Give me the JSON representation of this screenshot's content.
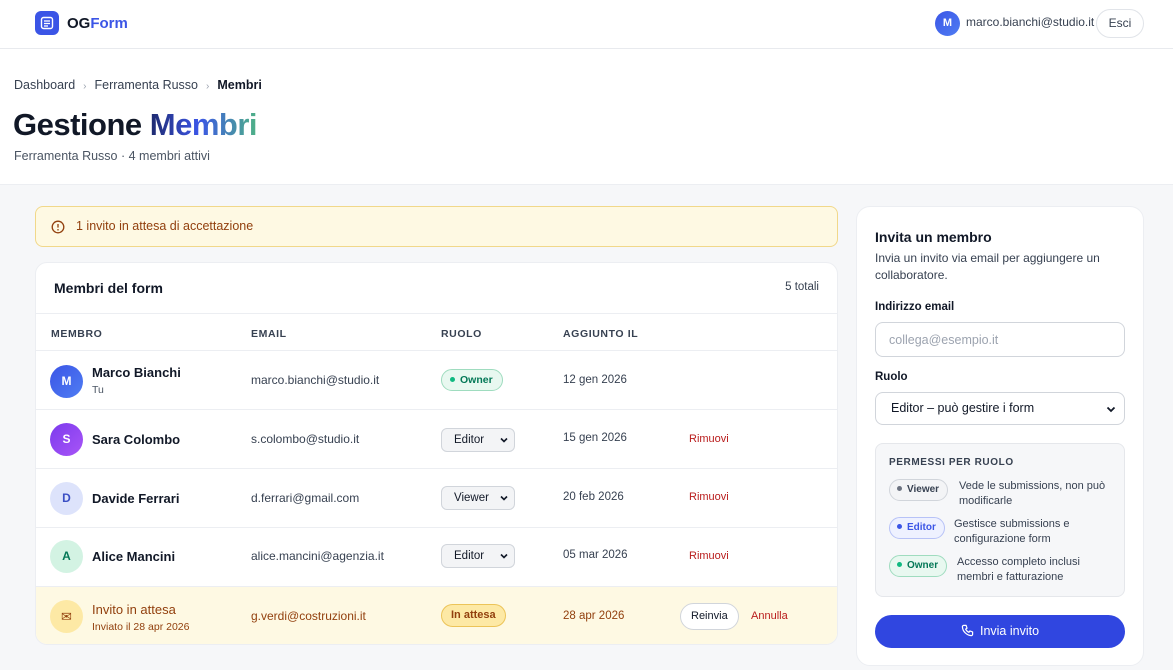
{
  "app": {
    "brand_1": "OG",
    "brand_2": "Form"
  },
  "user": {
    "initial": "M",
    "email": "marco.bianchi@studio.it",
    "logout_label": "Esci"
  },
  "breadcrumb": {
    "item_1": "Dashboard",
    "item_2": "Ferramenta Russo",
    "current": "Membri"
  },
  "page": {
    "title_1": "Gestione ",
    "title_2": "Membri",
    "subtitle": "Ferramenta Russo · 4 membri attivi"
  },
  "alert": {
    "text": "1 invito in attesa di accettazione"
  },
  "members_card": {
    "title": "Membri del form",
    "count": "5 totali",
    "columns": [
      "MEMBRO",
      "EMAIL",
      "RUOLO",
      "AGGIUNTO IL"
    ],
    "remove_label": "Rimuovi",
    "rows": [
      {
        "initial": "M",
        "name": "Marco Bianchi",
        "sub": "Tu",
        "email": "marco.bianchi@studio.it",
        "role": "Owner",
        "date": "12 gen 2026"
      },
      {
        "initial": "S",
        "name": "Sara Colombo",
        "email": "s.colombo@studio.it",
        "role": "Editor",
        "date": "15 gen 2026"
      },
      {
        "initial": "D",
        "name": "Davide Ferrari",
        "email": "d.ferrari@gmail.com",
        "role": "Viewer",
        "date": "20 feb 2026"
      },
      {
        "initial": "A",
        "name": "Alice Mancini",
        "email": "alice.mancini@agenzia.it",
        "role": "Editor",
        "date": "05 mar 2026"
      }
    ],
    "pending": {
      "icon": "✉",
      "name": "Invito in attesa",
      "sub": "Inviato il 28 apr 2026",
      "email": "g.verdi@costruzioni.it",
      "status": "In attesa",
      "date": "28 apr 2026",
      "resend_label": "Reinvia",
      "cancel_label": "Annulla"
    }
  },
  "invite_panel": {
    "title": "Invita un membro",
    "description": "Invia un invito via email per aggiungere un collaboratore.",
    "email_label": "Indirizzo email",
    "email_placeholder": "collega@esempio.it",
    "role_label": "Ruolo",
    "role_value": "Editor – può gestire i form",
    "permissions": {
      "title": "PERMESSI PER RUOLO",
      "items": [
        {
          "role": "Viewer",
          "desc": "Vede le submissions, non può modificarle"
        },
        {
          "role": "Editor",
          "desc": "Gestisce submissions e configurazione form"
        },
        {
          "role": "Owner",
          "desc": "Accesso completo inclusi membri e fatturazione"
        }
      ]
    },
    "submit_label": "Invia invito"
  }
}
